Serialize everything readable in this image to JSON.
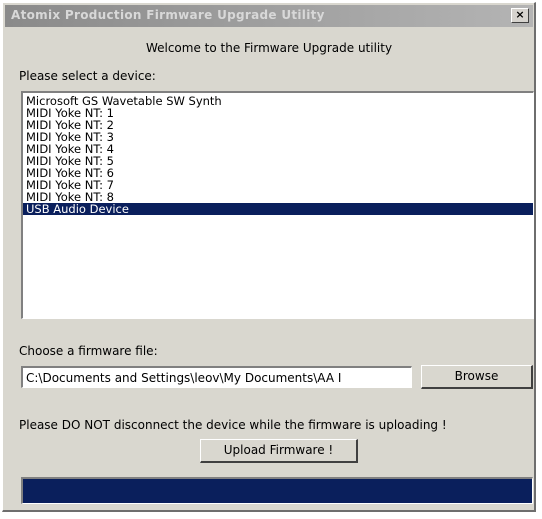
{
  "window": {
    "title": "Atomix Production Firmware Upgrade Utility",
    "close_label": "×"
  },
  "welcome_text": "Welcome to the Firmware Upgrade utility",
  "device_select_label": "Please select a device:",
  "devices": [
    {
      "label": "Microsoft GS Wavetable SW Synth",
      "selected": false
    },
    {
      "label": "MIDI Yoke NT:  1",
      "selected": false
    },
    {
      "label": "MIDI Yoke NT:  2",
      "selected": false
    },
    {
      "label": "MIDI Yoke NT:  3",
      "selected": false
    },
    {
      "label": "MIDI Yoke NT:  4",
      "selected": false
    },
    {
      "label": "MIDI Yoke NT:  5",
      "selected": false
    },
    {
      "label": "MIDI Yoke NT:  6",
      "selected": false
    },
    {
      "label": "MIDI Yoke NT:  7",
      "selected": false
    },
    {
      "label": "MIDI Yoke NT:  8",
      "selected": false
    },
    {
      "label": "USB Audio Device",
      "selected": true
    }
  ],
  "firmware_label": "Choose a firmware file:",
  "firmware_path": "C:\\Documents and Settings\\leov\\My Documents\\AA I",
  "browse_label": "Browse",
  "warning_text": "Please DO NOT disconnect the device while the firmware is uploading !",
  "upload_label": "Upload Firmware !",
  "progress_fraction": 1.0,
  "colors": {
    "selection": "#0a1f5c",
    "progress": "#0a1f5c",
    "dialog_bg": "#d9d7cf"
  }
}
